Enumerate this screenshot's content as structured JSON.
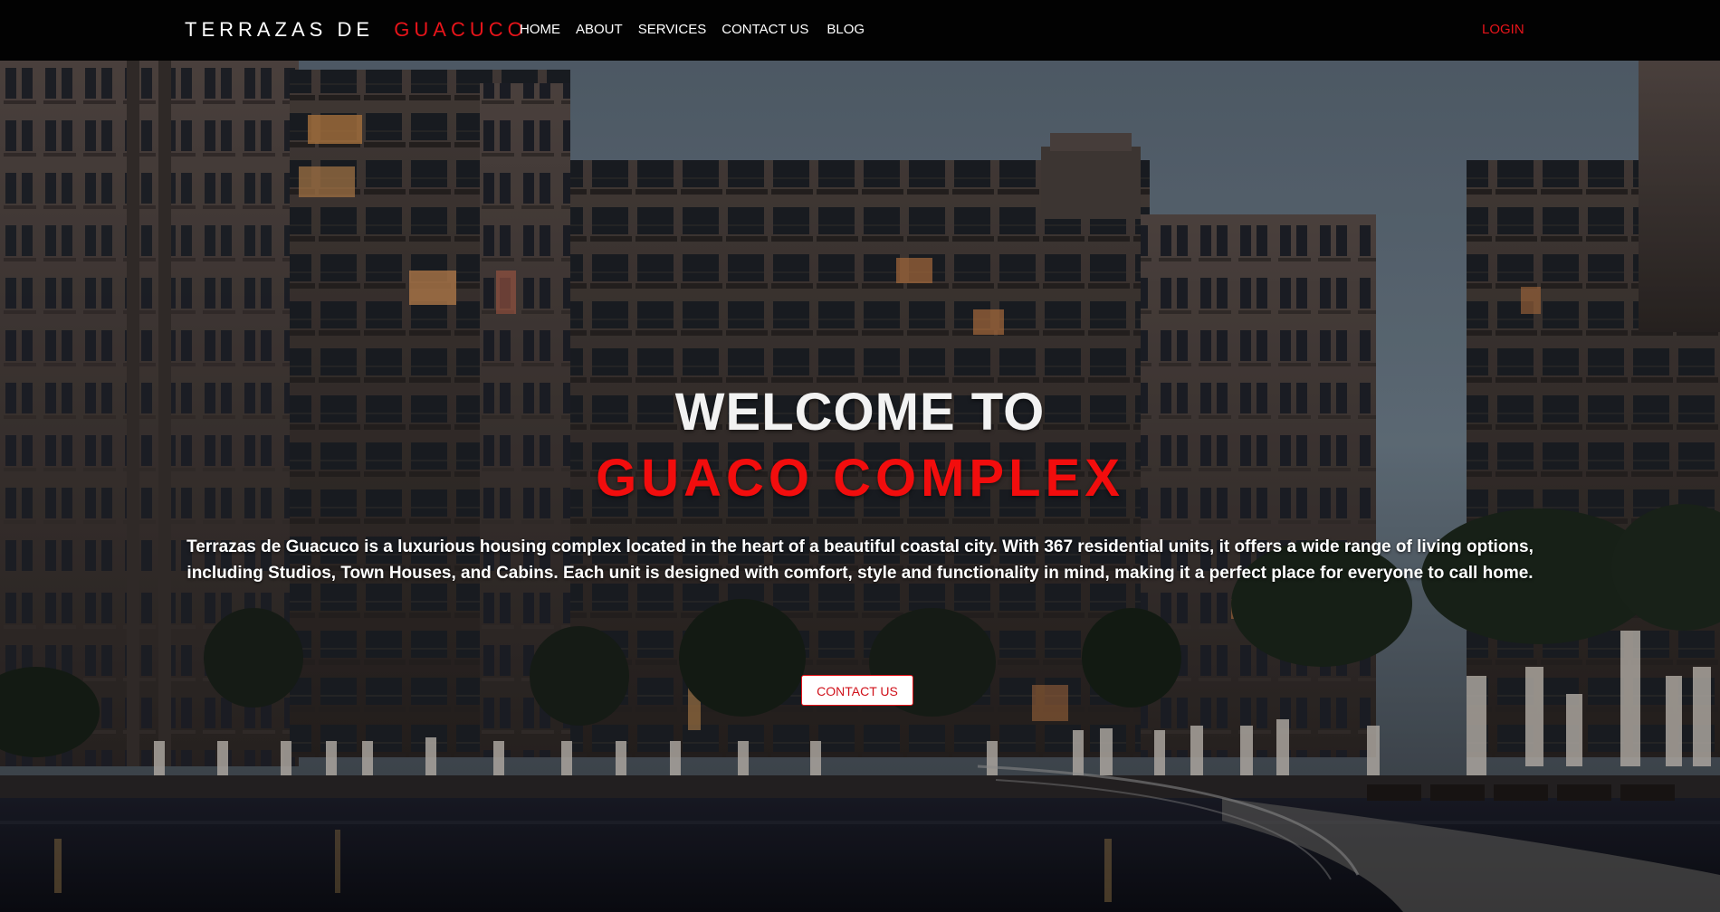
{
  "brand": {
    "prefix": "TERRAZAS DE",
    "accent": "GUACUCO"
  },
  "nav": {
    "items": [
      {
        "label": "HOME"
      },
      {
        "label": "ABOUT"
      },
      {
        "label": "SERVICES"
      },
      {
        "label": "CONTACT US"
      },
      {
        "label": "BLOG"
      }
    ],
    "login_label": "LOGIN"
  },
  "hero": {
    "title_line1": "WELCOME TO",
    "title_line2": "GUACO COMPLEX",
    "description": "Terrazas de Guacuco is a luxurious housing complex located in the heart of a beautiful coastal city. With 367 residential units, it offers a wide range of living options, including Studios, Town Houses, and Cabins. Each unit is designed with comfort, style and functionality in mind, making it a perfect place for everyone to call home.",
    "cta_label": "CONTACT US"
  },
  "colors": {
    "accent": "#e8141a",
    "navbar_bg": "#020202",
    "text": "#ffffff"
  }
}
